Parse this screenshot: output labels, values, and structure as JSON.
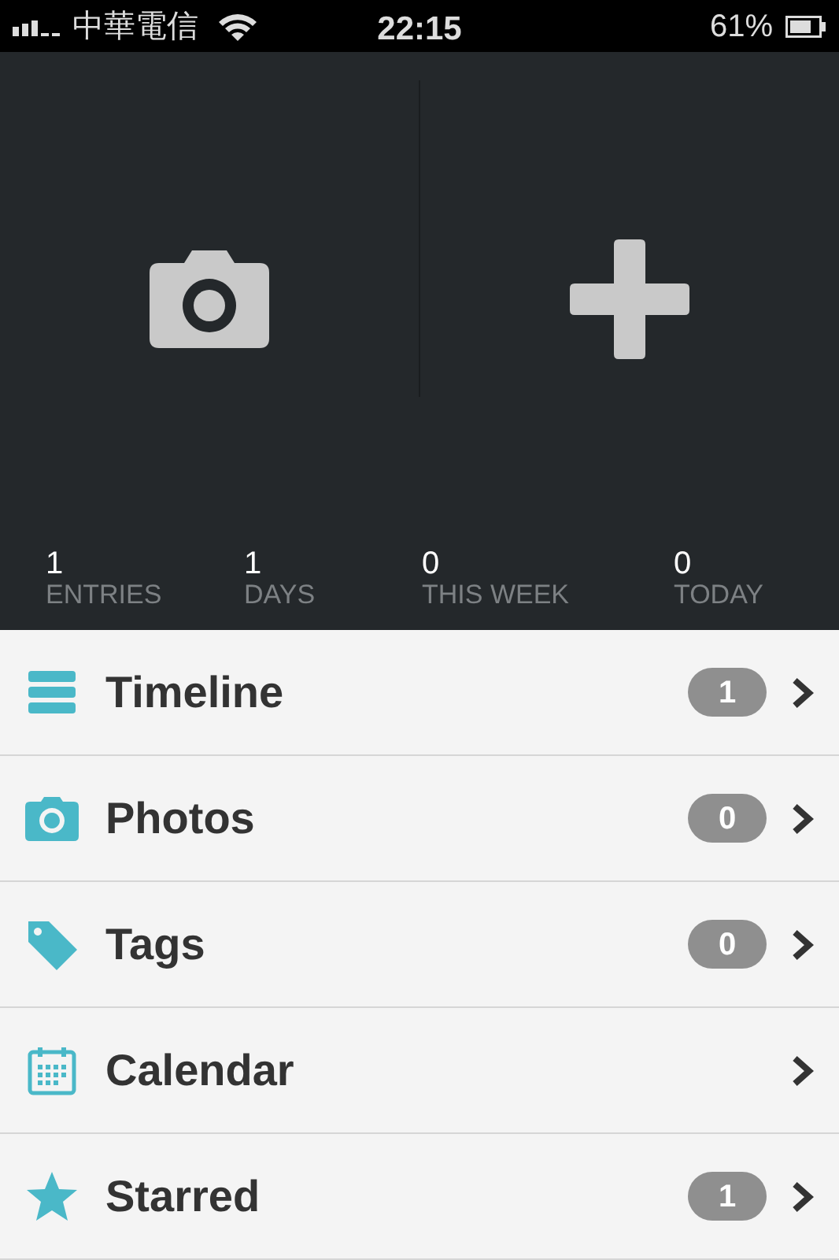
{
  "status_bar": {
    "carrier": "中華電信",
    "time": "22:15",
    "battery": "61%"
  },
  "actions": [
    {
      "kind": "camera"
    },
    {
      "kind": "add"
    }
  ],
  "stats": [
    {
      "value": "1",
      "label": "ENTRIES"
    },
    {
      "value": "1",
      "label": "DAYS"
    },
    {
      "value": "0",
      "label": "THIS WEEK"
    },
    {
      "value": "0",
      "label": "TODAY"
    }
  ],
  "menu": [
    {
      "kind": "timeline",
      "label": "Timeline",
      "count": "1"
    },
    {
      "kind": "photos",
      "label": "Photos",
      "count": "0"
    },
    {
      "kind": "tags",
      "label": "Tags",
      "count": "0"
    },
    {
      "kind": "calendar",
      "label": "Calendar"
    },
    {
      "kind": "starred",
      "label": "Starred",
      "count": "1"
    }
  ]
}
